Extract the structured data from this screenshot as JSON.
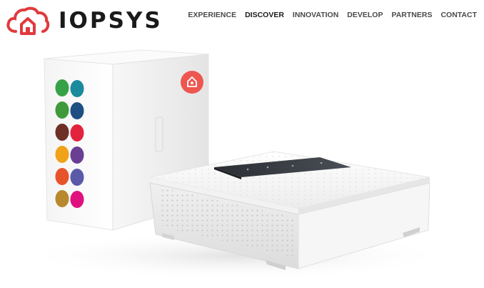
{
  "brand": {
    "name": "IOPSYS",
    "accent_color": "#e03a3e",
    "logo_icon": "cloud-house-icon"
  },
  "nav": {
    "items": [
      {
        "label": "EXPERIENCE",
        "active": false
      },
      {
        "label": "DISCOVER",
        "active": true
      },
      {
        "label": "INNOVATION",
        "active": false
      },
      {
        "label": "DEVELOP",
        "active": false
      },
      {
        "label": "PARTNERS",
        "active": false
      },
      {
        "label": "CONTACT",
        "active": false
      }
    ]
  },
  "hero": {
    "box_dot_colors": [
      "#36a146",
      "#1a8b9c",
      "#3e9a3a",
      "#1d4f82",
      "#6e2f26",
      "#e3223d",
      "#f0a21a",
      "#6a3f93",
      "#e8542a",
      "#5b5aa8",
      "#b8882c",
      "#e0117e"
    ],
    "box_sticker_color": "#ee5650",
    "sticker_icon": "house-badge-icon"
  }
}
